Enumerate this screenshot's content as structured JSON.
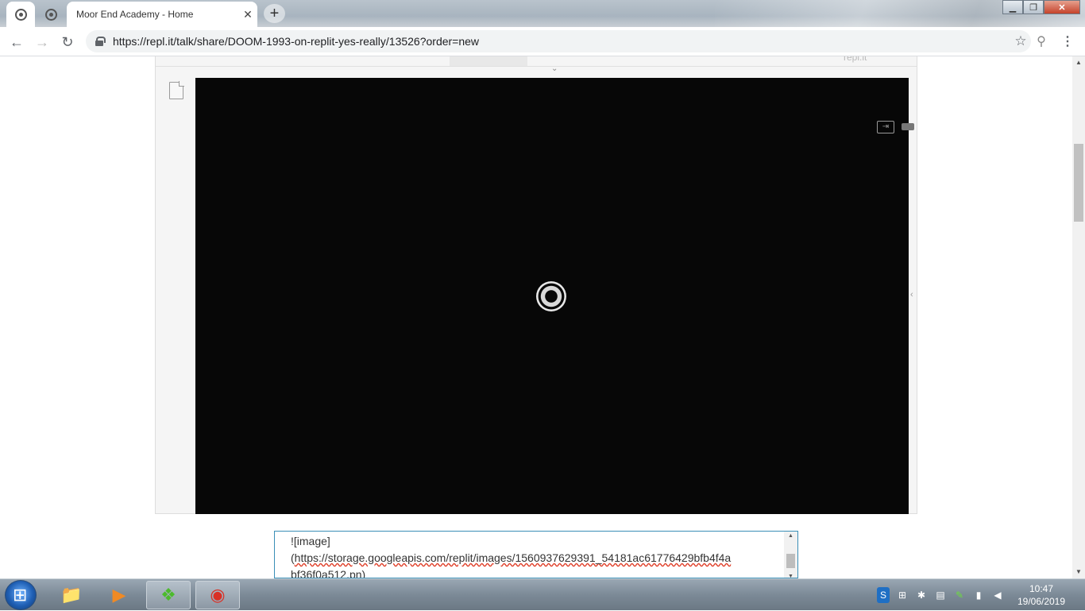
{
  "browser": {
    "tabs": [
      {
        "title": "",
        "icon": "replit-spiral-icon",
        "active": true
      },
      {
        "title": "",
        "icon": "replit-spiral-icon",
        "active": false
      },
      {
        "title": "Moor End Academy - Home",
        "icon": "",
        "active": false
      }
    ],
    "tab_close": "✕",
    "new_tab": "+",
    "window_controls": {
      "minimize": "▁",
      "maximize": "❐",
      "close": "✕"
    },
    "nav": {
      "back": "←",
      "forward": "→",
      "reload": "↻"
    },
    "url": "https://repl.it/talk/share/DOOM-1993-on-replit-yes-really/13526?order=new",
    "bookmark_star": "☆",
    "menu": "⋮"
  },
  "page": {
    "embed": {
      "logo_text": "repl.it",
      "collapse_chevron": "⌄",
      "side_chevron": "‹",
      "console_ctrl": "⇥"
    },
    "reply": {
      "line1": "![image]",
      "line2_prefix": "(",
      "line2_url": "https://storage.googleapis.com/replit/images/1560937629391_54181ac61776429bfb4f4a",
      "line3": "bf36f0a512.pn)"
    }
  },
  "taskbar": {
    "apps": [
      {
        "name": "explorer",
        "icon": "📁"
      },
      {
        "name": "media",
        "icon": "▶"
      },
      {
        "name": "green-app",
        "icon": "❖"
      },
      {
        "name": "chrome",
        "icon": "◉"
      }
    ],
    "tray": [
      "S",
      "⊞",
      "✱",
      "▤",
      "✎",
      "▮",
      "◀"
    ],
    "time": "10:47",
    "date": "19/06/2019"
  },
  "colors": {
    "console_bg": "#070707",
    "reply_border": "#3a8fb7",
    "tab_bar": "#a8b4bf"
  }
}
